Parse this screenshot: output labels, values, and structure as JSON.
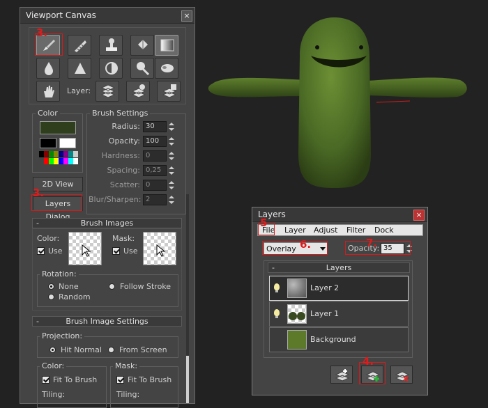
{
  "canvas_panel": {
    "title": "Viewport Canvas",
    "close_glyph": "×",
    "tools_row1": [
      "paint-brush-icon",
      "ruler-icon",
      "stamp-icon",
      "fill-bucket-icon",
      "gradient-icon"
    ],
    "tools_row2": [
      "blur-drop-icon",
      "sharpen-icon",
      "contrast-icon",
      "smudge-icon",
      "hand-smudge-icon"
    ],
    "pan_tool": "hand-icon",
    "layer_label": "Layer:",
    "layer_buttons": [
      "layer-stack-icon",
      "layer-add-icon",
      "layer-save-icon"
    ],
    "color_group": "Color",
    "view_2d": "2D View",
    "layers_dialog": "Layers Dialog",
    "brush_settings": {
      "title": "Brush Settings",
      "fields": [
        {
          "label": "Radius:",
          "value": "30",
          "disabled": false
        },
        {
          "label": "Opacity:",
          "value": "100",
          "disabled": false
        },
        {
          "label": "Hardness:",
          "value": "0",
          "disabled": true
        },
        {
          "label": "Spacing:",
          "value": "0,25",
          "disabled": true
        },
        {
          "label": "Scatter:",
          "value": "0",
          "disabled": true
        },
        {
          "label": "Blur/Sharpen:",
          "value": "2",
          "disabled": true
        }
      ]
    },
    "brush_images": {
      "title": "Brush Images",
      "color_label": "Color:",
      "mask_label": "Mask:",
      "use_label": "Use",
      "use_label_2": "Use",
      "rotation_label": "Rotation:",
      "none": "None",
      "follow_stroke": "Follow Stroke",
      "random": "Random"
    },
    "brush_image_settings": {
      "title": "Brush Image Settings",
      "projection_label": "Projection:",
      "hit_normal": "Hit Normal",
      "from_screen": "From Screen",
      "color_label": "Color:",
      "mask_label": "Mask:",
      "fit_color": "Fit To Brush",
      "fit_mask": "Fit To Brush",
      "tiling_color": "Tiling:",
      "tiling_mask": "Tiling:"
    },
    "collapse_glyph": "-"
  },
  "layers_dialog": {
    "title": "Layers",
    "close_glyph": "×",
    "menu": [
      "File",
      "Layer",
      "Adjust",
      "Filter",
      "Dock"
    ],
    "blend_mode": "Overlay",
    "opacity_label": "Opacity:",
    "opacity_value": "35",
    "group_title": "Layers",
    "layers": [
      {
        "name": "Layer 2",
        "selected": true
      },
      {
        "name": "Layer 1",
        "selected": false
      },
      {
        "name": "Background",
        "selected": false
      }
    ],
    "bottom_buttons": [
      "new-layer-icon",
      "duplicate-layer-icon",
      "delete-layer-icon"
    ]
  },
  "annotations": [
    "3.",
    "3.",
    "4.",
    "5",
    "6.",
    "7."
  ],
  "colors": {
    "panel_bg": "#444444",
    "highlight": "#d21c1c",
    "foreground_swatch": "#2f3f1e",
    "character_green": "#4a6a25"
  }
}
